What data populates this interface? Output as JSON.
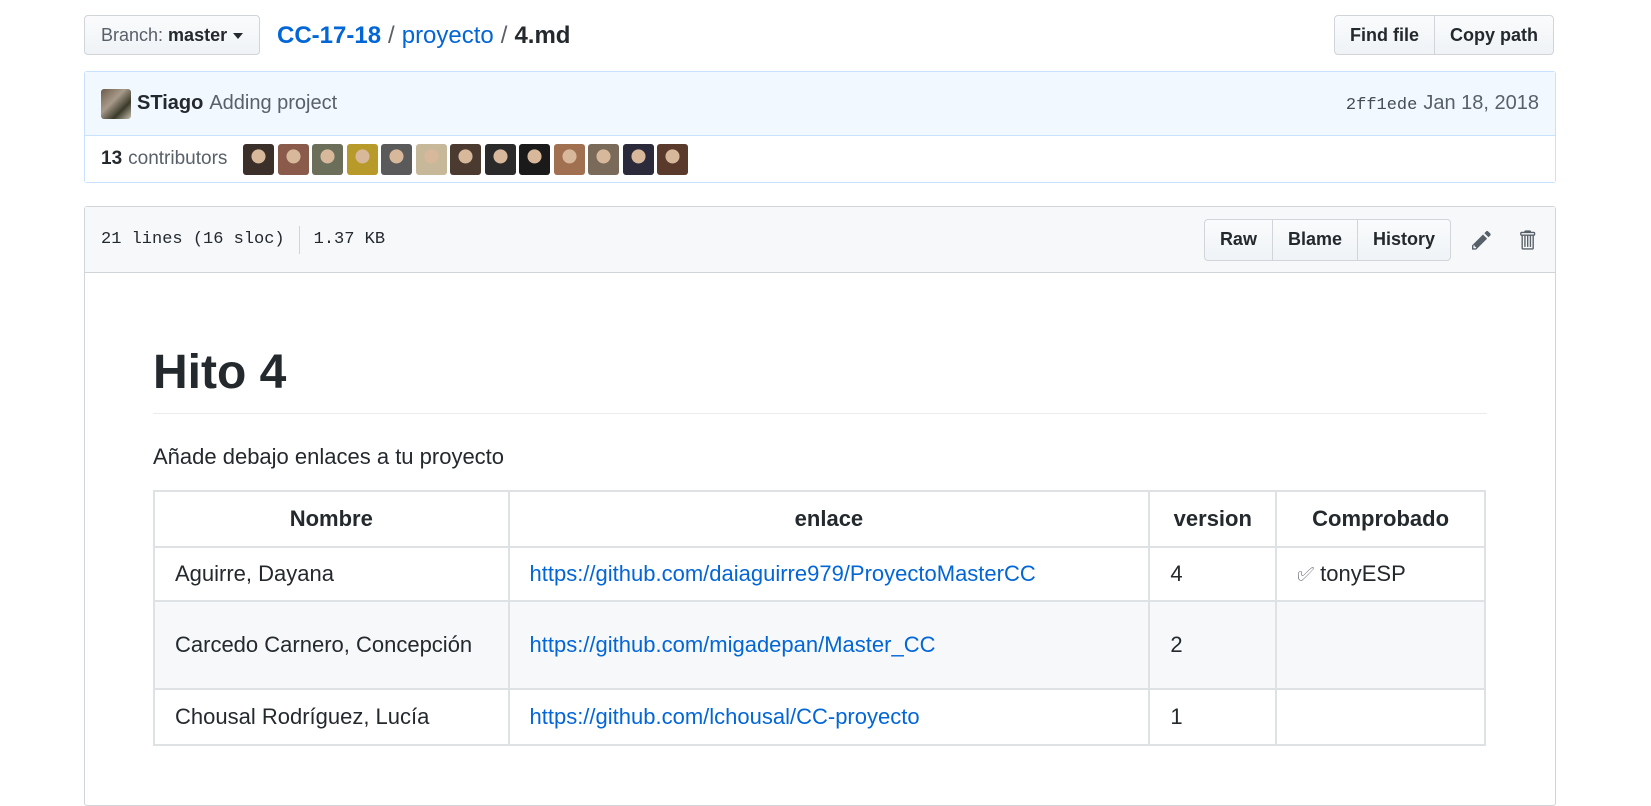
{
  "branch": {
    "prefix": "Branch:",
    "name": "master"
  },
  "breadcrumb": {
    "repo": "CC-17-18",
    "folder": "proyecto",
    "file": "4.md",
    "separator": "/"
  },
  "file_nav": {
    "find_file": "Find file",
    "copy_path": "Copy path"
  },
  "commit": {
    "author": "STiago",
    "message": "Adding project",
    "sha": "2ff1ede",
    "date": "Jan 18, 2018"
  },
  "contributors": {
    "count": "13",
    "label": "contributors",
    "avatar_colors": [
      "#3b2f2a",
      "#8a5a4a",
      "#6b6f5a",
      "#b89a2a",
      "#5a5a5a",
      "#c8b89a",
      "#4a3a30",
      "#2a2a2a",
      "#1a1a1a",
      "#a07050",
      "#7a6a5a",
      "#2a2a3a",
      "#5a3a2a"
    ]
  },
  "file_info": {
    "lines": "21 lines (16 sloc)",
    "size": "1.37 KB"
  },
  "file_actions": {
    "raw": "Raw",
    "blame": "Blame",
    "history": "History"
  },
  "readme": {
    "title": "Hito 4",
    "intro": "Añade debajo enlaces a tu proyecto",
    "table": {
      "headers": [
        "Nombre",
        "enlace",
        "version",
        "Comprobado"
      ],
      "rows": [
        {
          "nombre": "Aguirre, Dayana",
          "enlace": "https://github.com/daiaguirre979/ProyectoMasterCC",
          "version": "4",
          "comprobado": "tonyESP"
        },
        {
          "nombre": "Carcedo Carnero, Concepción",
          "enlace": "https://github.com/migadepan/Master_CC",
          "version": "2",
          "comprobado": ""
        },
        {
          "nombre": "Chousal Rodríguez, Lucía",
          "enlace": "https://github.com/lchousal/CC-proyecto",
          "version": "1",
          "comprobado": ""
        }
      ]
    }
  }
}
